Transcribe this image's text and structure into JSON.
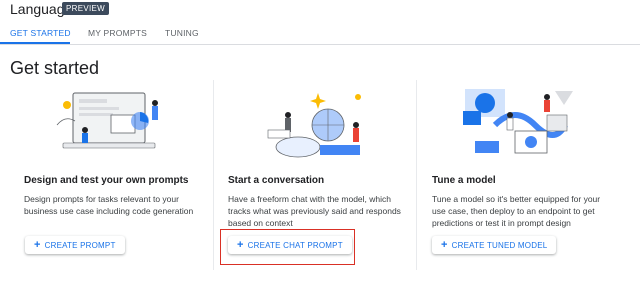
{
  "header": {
    "title": "Language",
    "badge": "PREVIEW"
  },
  "tabs": [
    {
      "label": "GET STARTED",
      "active": true
    },
    {
      "label": "MY PROMPTS",
      "active": false
    },
    {
      "label": "TUNING",
      "active": false
    }
  ],
  "page_title": "Get started",
  "cards": [
    {
      "title": "Design and test your own prompts",
      "description": "Design prompts for tasks relevant to your business use case including code generation",
      "button": "CREATE PROMPT",
      "illustration": "prompt-design-illustration"
    },
    {
      "title": "Start a conversation",
      "description": "Have a freeform chat with the model, which tracks what was previously said and responds based on context",
      "button": "CREATE CHAT PROMPT",
      "illustration": "conversation-illustration"
    },
    {
      "title": "Tune a model",
      "description": "Tune a model so it's better equipped for your use case, then deploy to an endpoint to get predictions or test it in prompt design",
      "button": "CREATE TUNED MODEL",
      "illustration": "tune-model-illustration"
    }
  ],
  "colors": {
    "accent": "#1a73e8",
    "highlight": "#d93025",
    "badge_bg": "#3c4a5c"
  }
}
